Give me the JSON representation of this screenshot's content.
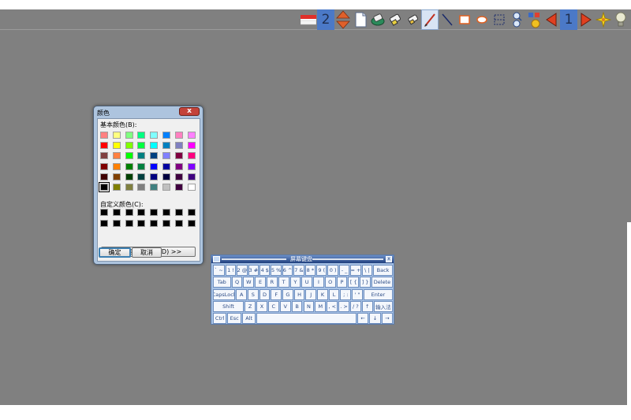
{
  "toolbar": {
    "page_number": "2",
    "current_number": "1",
    "icons": [
      "flag-icon",
      "page-number-2",
      "up-down-arrows-icon",
      "blank-page-icon",
      "eraser-green-icon",
      "eraser-icon",
      "eraser-small-icon",
      "pen-icon",
      "line-icon",
      "rectangle-icon",
      "ellipse-icon",
      "select-icon",
      "zoom-icon",
      "stamp-icon",
      "previous-icon",
      "page-number-1",
      "next-icon",
      "sparkle-icon",
      "bulb-icon",
      "chart-icon"
    ]
  },
  "color_dialog": {
    "title": "颜色",
    "close_label": "x",
    "basic_colors_label": "基本颜色(B):",
    "custom_colors_label": "自定义颜色(C):",
    "define_custom_label": "规定自定义颜色(D) >>",
    "ok_label": "确定",
    "cancel_label": "取消",
    "basic_colors": [
      [
        "#ff8080",
        "#ffff80",
        "#80ff80",
        "#00ff80",
        "#80ffff",
        "#0080ff",
        "#ff80c0",
        "#ff80ff"
      ],
      [
        "#ff0000",
        "#ffff00",
        "#80ff00",
        "#00ff40",
        "#00ffff",
        "#0080c0",
        "#8080c0",
        "#ff00ff"
      ],
      [
        "#804040",
        "#ff8040",
        "#00ff00",
        "#008080",
        "#004080",
        "#8080ff",
        "#800040",
        "#ff0080"
      ],
      [
        "#800000",
        "#ff8000",
        "#008000",
        "#008040",
        "#0000ff",
        "#0000a0",
        "#800080",
        "#8000ff"
      ],
      [
        "#400000",
        "#804000",
        "#004000",
        "#004040",
        "#000080",
        "#000040",
        "#400040",
        "#400080"
      ],
      [
        "#000000",
        "#808000",
        "#808040",
        "#808080",
        "#408080",
        "#c0c0c0",
        "#400040",
        "#ffffff"
      ]
    ],
    "selected_basic": [
      5,
      0
    ],
    "custom_colors": [
      [
        "#000000",
        "#000000",
        "#000000",
        "#000000",
        "#000000",
        "#000000",
        "#000000",
        "#000000"
      ],
      [
        "#000000",
        "#000000",
        "#000000",
        "#000000",
        "#000000",
        "#000000",
        "#000000",
        "#000000"
      ]
    ]
  },
  "keyboard": {
    "title": "屏幕键盘",
    "close_label": "x",
    "rows": [
      [
        {
          "label": "` ~",
          "w": 1.1
        },
        {
          "label": "1 !",
          "w": 1
        },
        {
          "label": "2 @",
          "w": 1
        },
        {
          "label": "3 #",
          "w": 1
        },
        {
          "label": "4 $",
          "w": 1
        },
        {
          "label": "5 %",
          "w": 1
        },
        {
          "label": "6 ^",
          "w": 1
        },
        {
          "label": "7 &",
          "w": 1
        },
        {
          "label": "8 *",
          "w": 1
        },
        {
          "label": "9 (",
          "w": 1
        },
        {
          "label": "0 )",
          "w": 1
        },
        {
          "label": "- _",
          "w": 1
        },
        {
          "label": "= +",
          "w": 1
        },
        {
          "label": "\\ |",
          "w": 1
        },
        {
          "label": "Back",
          "w": 1.8
        }
      ],
      [
        {
          "label": "Tab",
          "w": 1.6
        },
        {
          "label": "Q",
          "w": 1
        },
        {
          "label": "W",
          "w": 1
        },
        {
          "label": "E",
          "w": 1
        },
        {
          "label": "R",
          "w": 1
        },
        {
          "label": "T",
          "w": 1
        },
        {
          "label": "Y",
          "w": 1
        },
        {
          "label": "U",
          "w": 1
        },
        {
          "label": "I",
          "w": 1
        },
        {
          "label": "O",
          "w": 1
        },
        {
          "label": "P",
          "w": 1
        },
        {
          "label": "[ {",
          "w": 1
        },
        {
          "label": "] }",
          "w": 1
        },
        {
          "label": "Delete",
          "w": 1.9
        }
      ],
      [
        {
          "label": "CapsLock",
          "w": 2
        },
        {
          "label": "A",
          "w": 1
        },
        {
          "label": "S",
          "w": 1
        },
        {
          "label": "D",
          "w": 1
        },
        {
          "label": "F",
          "w": 1
        },
        {
          "label": "G",
          "w": 1
        },
        {
          "label": "H",
          "w": 1
        },
        {
          "label": "J",
          "w": 1
        },
        {
          "label": "K",
          "w": 1
        },
        {
          "label": "L",
          "w": 1
        },
        {
          "label": "; :",
          "w": 1
        },
        {
          "label": "' \"",
          "w": 1
        },
        {
          "label": "Enter",
          "w": 2.6
        }
      ],
      [
        {
          "label": "Shift",
          "w": 2.7
        },
        {
          "label": "Z",
          "w": 1
        },
        {
          "label": "X",
          "w": 1
        },
        {
          "label": "C",
          "w": 1
        },
        {
          "label": "V",
          "w": 1
        },
        {
          "label": "B",
          "w": 1
        },
        {
          "label": "N",
          "w": 1
        },
        {
          "label": "M",
          "w": 1
        },
        {
          "label": ", <",
          "w": 1
        },
        {
          "label": ". >",
          "w": 1
        },
        {
          "label": "/ ?",
          "w": 1
        },
        {
          "label": "↑",
          "w": 1
        },
        {
          "label": "输入法",
          "w": 1.7
        }
      ],
      [
        {
          "label": "Ctrl",
          "w": 1.2
        },
        {
          "label": "Esc",
          "w": 1.2
        },
        {
          "label": "Alt",
          "w": 1.2
        },
        {
          "label": "",
          "w": 8.3
        },
        {
          "label": "←",
          "w": 1
        },
        {
          "label": "↓",
          "w": 1
        },
        {
          "label": "→",
          "w": 1
        }
      ]
    ]
  }
}
